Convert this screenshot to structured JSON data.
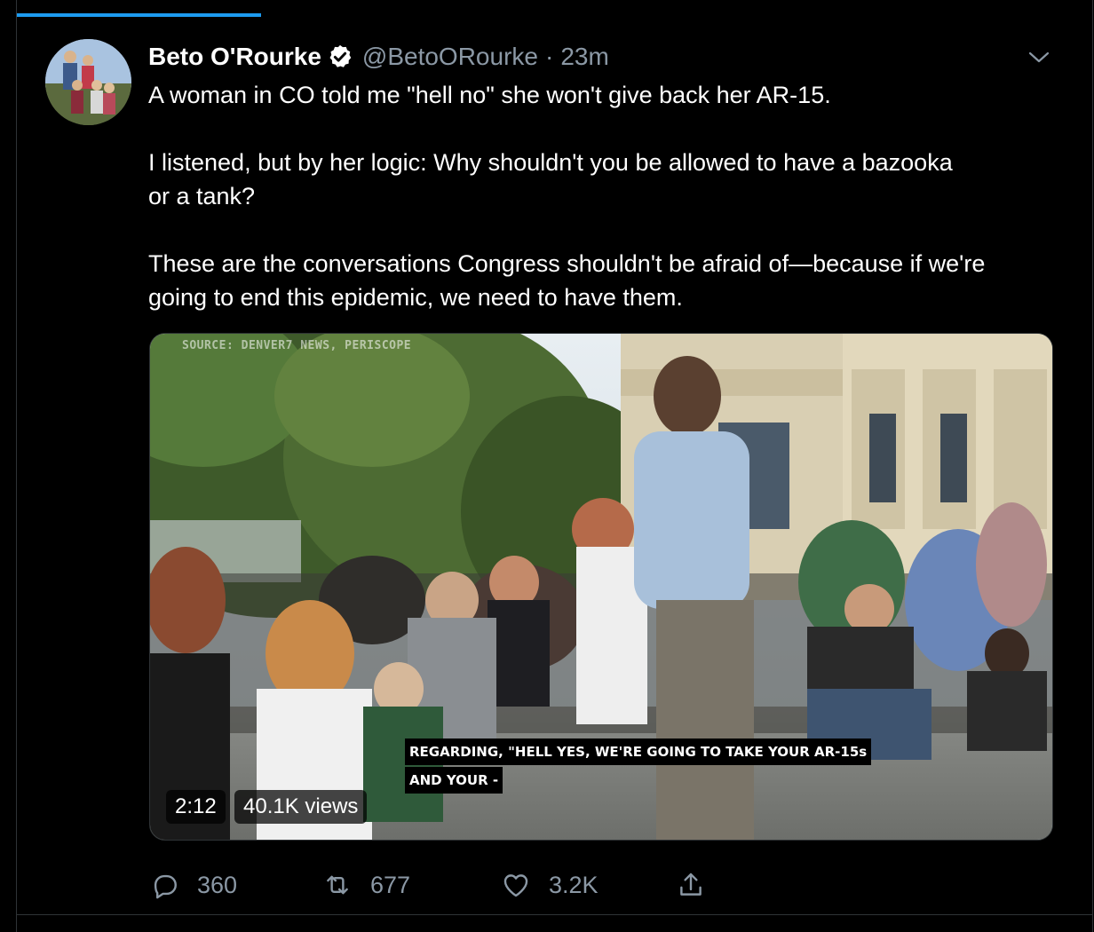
{
  "tweet": {
    "author_name": "Beto O'Rourke",
    "handle": "@BetoORourke",
    "separator": "·",
    "time": "23m",
    "text": [
      "A woman in CO told me \"hell no\" she won't give back her AR-15.",
      "I listened, but by her logic: Why shouldn't you be allowed to have a bazooka or a tank?",
      "These are the conversations Congress shouldn't be afraid of—because if we're going to end this epidemic, we need to have them."
    ]
  },
  "media": {
    "source_label": "SOURCE: DENVER7 NEWS, PERISCOPE",
    "caption_line1": "REGARDING, \"HELL YES, WE'RE GOING TO TAKE YOUR AR-15s",
    "caption_line2": "AND YOUR -",
    "duration": "2:12",
    "views": "40.1K views"
  },
  "actions": {
    "reply_count": "360",
    "retweet_count": "677",
    "like_count": "3.2K"
  },
  "icons": {
    "verified": "verified-badge-icon",
    "more": "chevron-down-icon",
    "reply": "reply-icon",
    "retweet": "retweet-icon",
    "like": "heart-icon",
    "share": "share-icon"
  },
  "colors": {
    "background": "#000000",
    "accent": "#1d9bf0",
    "secondary_text": "#8b98a5",
    "border": "#2f3336"
  }
}
